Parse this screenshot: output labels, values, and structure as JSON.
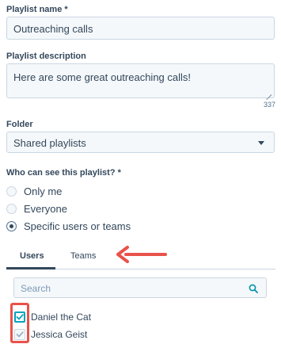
{
  "playlist_name": {
    "label": "Playlist name *",
    "value": "Outreaching calls"
  },
  "playlist_description": {
    "label": "Playlist description",
    "value": "Here are some great outreaching calls!",
    "char_count": "337"
  },
  "folder": {
    "label": "Folder",
    "selected": "Shared playlists"
  },
  "visibility": {
    "label": "Who can see this playlist? *",
    "options": [
      {
        "label": "Only me",
        "checked": false
      },
      {
        "label": "Everyone",
        "checked": false
      },
      {
        "label": "Specific users or teams",
        "checked": true
      }
    ]
  },
  "tabs": [
    {
      "label": "Users",
      "active": true
    },
    {
      "label": "Teams",
      "active": false
    }
  ],
  "search": {
    "placeholder": "Search",
    "icon": "search-icon"
  },
  "users": [
    {
      "name": "Daniel the Cat",
      "checked": true
    },
    {
      "name": "Jessica Geist",
      "checked": true,
      "disabled": true
    }
  ],
  "colors": {
    "text": "#33475b",
    "field_bg": "#f5f8fa",
    "border": "#cbd6e2",
    "accent": "#00a4bd",
    "annotation": "#e9524a"
  }
}
